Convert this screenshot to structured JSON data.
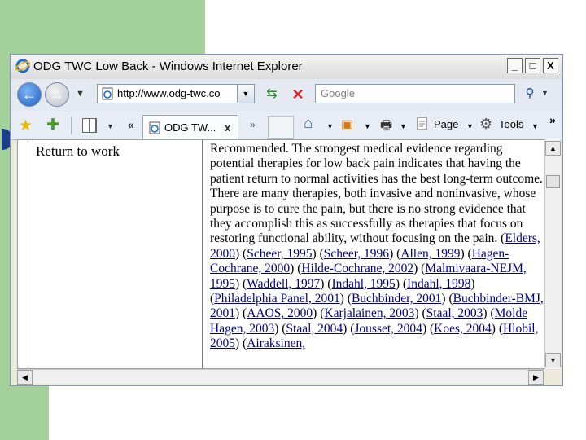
{
  "window": {
    "title": "ODG TWC Low Back - Windows Internet Explorer",
    "minimize": "_",
    "maximize": "□",
    "close": "X"
  },
  "nav": {
    "address": "http://www.odg-twc.co",
    "search_placeholder": "Google"
  },
  "tabs": {
    "active_label": "ODG TW...",
    "close": "x",
    "scroll_left": "«",
    "scroll_right": "»"
  },
  "command_bar": {
    "page_label": "Page",
    "tools_label": "Tools",
    "more": "»"
  },
  "content": {
    "row_label": "Return to work",
    "intro": "Recommended. The strongest medical evidence regarding potential therapies for low back pain indicates that having the patient return to normal activities has the best long-term outcome. There are many therapies, both invasive and noninvasive, whose purpose is to cure the pain, but there is no strong evidence that they accomplish this as successfully as therapies that focus on restoring functional ability, without focusing on the pain.",
    "citations": [
      "Elders, 2000",
      "Scheer, 1995",
      "Scheer, 1996",
      "Allen, 1999",
      "Hagen-Cochrane, 2000",
      "Hilde-Cochrane, 2002",
      "Malmivaara-NEJM, 1995",
      "Waddell, 1997",
      "Indahl, 1995",
      "Indahl, 1998",
      "Philadelphia Panel, 2001",
      "Buchbinder, 2001",
      "Buchbinder-BMJ, 2001",
      "AAOS, 2000",
      "Karjalainen, 2003",
      "Staal, 2003",
      "Molde Hagen, 2003",
      "Staal, 2004",
      "Jousset, 2004",
      "Koes, 2004",
      "Hlobil, 2005",
      "Airaksinen,"
    ]
  },
  "icons": {
    "back": "back-arrow-icon",
    "forward": "forward-arrow-icon",
    "refresh": "refresh-icon",
    "stop": "stop-icon",
    "search": "magnifier-icon",
    "favorites": "favorites-star-icon",
    "add_favorite": "add-favorite-icon",
    "home": "home-icon",
    "feeds": "feeds-icon",
    "print": "print-icon",
    "tools": "gear-icon"
  },
  "colors": {
    "slide_green": "#a3d09b",
    "link_blue": "#00008b",
    "bullet_blue": "#1c3f8a"
  }
}
